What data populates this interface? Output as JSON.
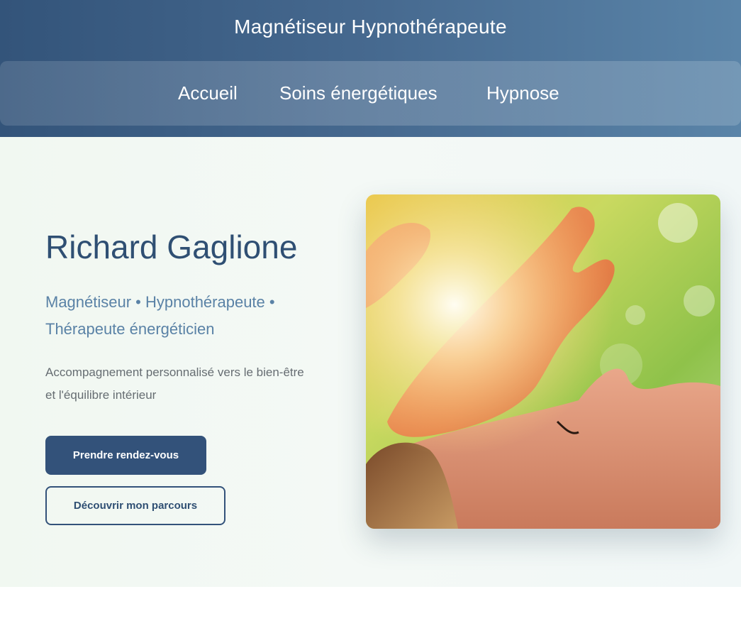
{
  "header": {
    "site_title": "Magnétiseur Hypnothérapeute",
    "nav": [
      {
        "label": "Accueil"
      },
      {
        "label": "Soins énergétiques"
      },
      {
        "label": "Hypnose"
      }
    ]
  },
  "hero": {
    "name": "Richard Gaglione",
    "roles_line1": "Magnétiseur • Hypnothérapeute •",
    "roles_line2": "Thérapeute énergéticien",
    "description_line1": "Accompagnement personnalisé vers le bien-être",
    "description_line2": "et l'équilibre intérieur",
    "primary_button": "Prendre rendez-vous",
    "secondary_button": "Découvrir mon parcours",
    "image_icon": "energy-healing-photo"
  },
  "colors": {
    "header_start": "#33547a",
    "header_end": "#5a84a8",
    "primary": "#33527a",
    "subtitle": "#5a82a6",
    "hero_bg": "#f1f8f1"
  }
}
